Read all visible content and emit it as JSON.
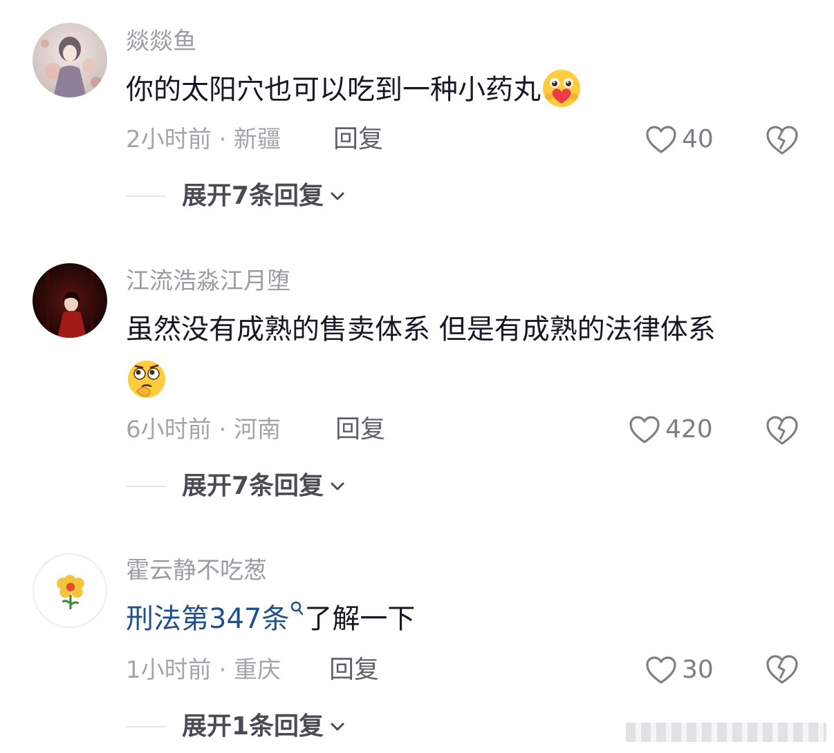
{
  "comments": [
    {
      "username": "燚燚鱼",
      "content": "你的太阳穴也可以吃到一种小药丸",
      "emoji": "heart-hug-emoji",
      "time_location": "2小时前 · 新疆",
      "reply_label": "回复",
      "likes": "40",
      "expand_label": "展开7条回复"
    },
    {
      "username": "江流浩淼江月堕",
      "content_line1": "虽然没有成熟的售卖体系  但是有成熟的法律体系",
      "emoji": "thinking-emoji",
      "time_location": "6小时前 · 河南",
      "reply_label": "回复",
      "likes": "420",
      "expand_label": "展开7条回复"
    },
    {
      "username": "霍云静不吃葱",
      "link_text": "刑法第347条",
      "content_rest": "了解一下",
      "time_location": "1小时前 · 重庆",
      "reply_label": "回复",
      "likes": "30",
      "expand_label": "展开1条回复"
    }
  ],
  "colors": {
    "username": "#9b9da3",
    "content": "#161823",
    "link": "#1f4f8c",
    "meta": "#a3a5aa"
  }
}
